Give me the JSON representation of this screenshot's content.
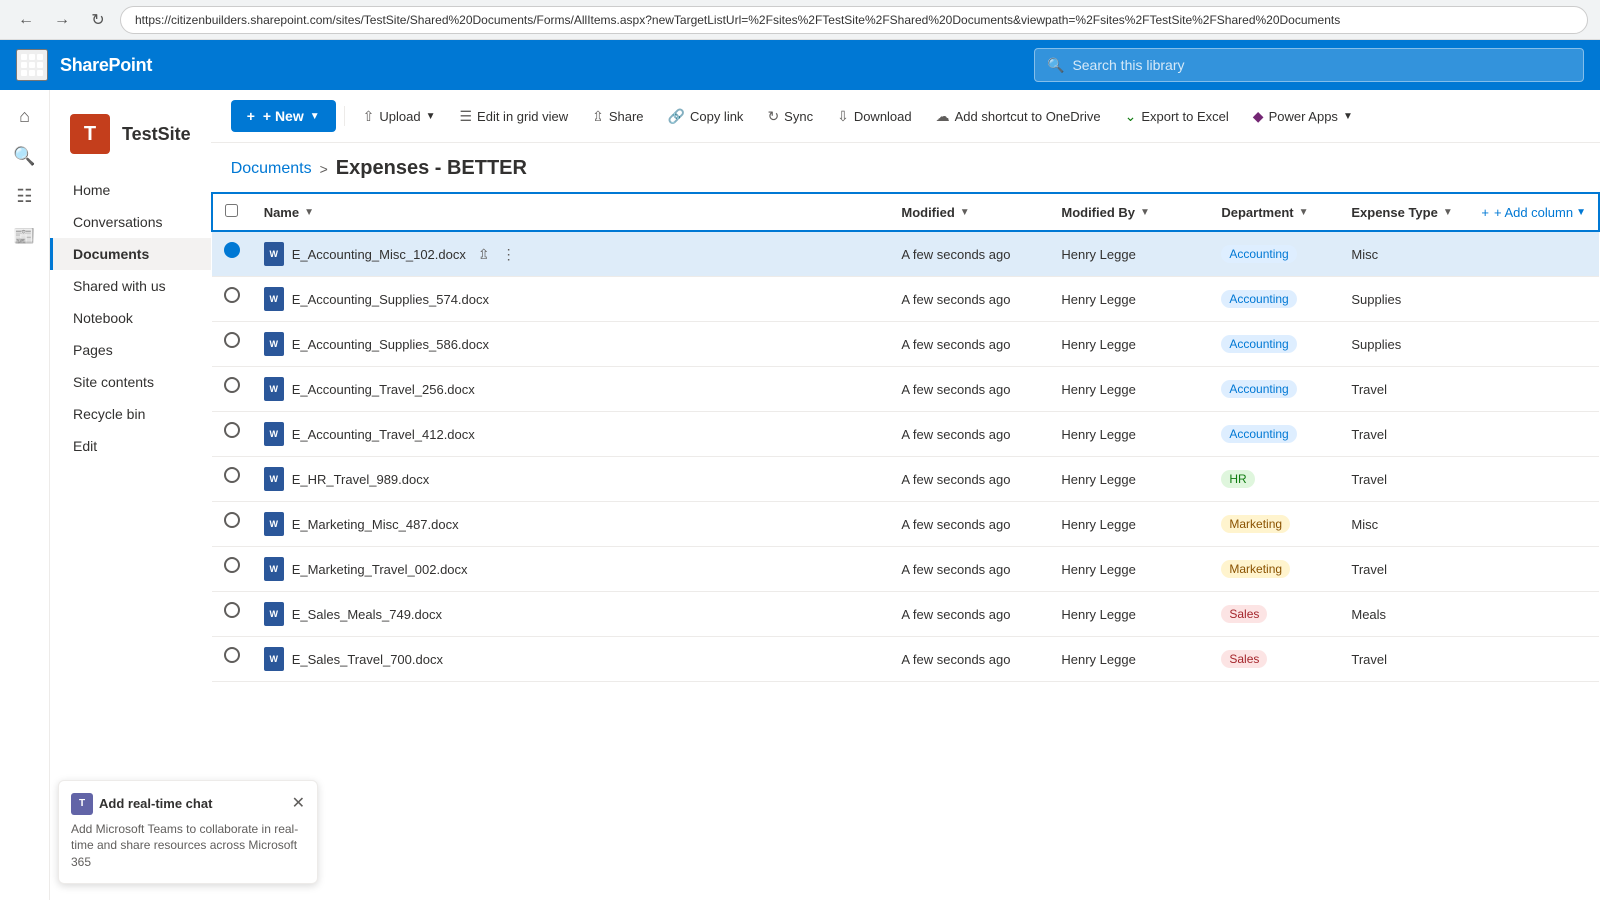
{
  "browser": {
    "address": "https://citizenbuilders.sharepoint.com/sites/TestSite/Shared%20Documents/Forms/AllItems.aspx?newTargetListUrl=%2Fsites%2FTestSite%2FShared%20Documents&viewpath=%2Fsites%2FTestSite%2FShared%20Documents"
  },
  "topnav": {
    "app_name": "SharePoint",
    "search_placeholder": "Search this library"
  },
  "site": {
    "logo_letter": "T",
    "name": "TestSite"
  },
  "nav": {
    "items": [
      {
        "label": "Home",
        "active": false
      },
      {
        "label": "Conversations",
        "active": false
      },
      {
        "label": "Documents",
        "active": true
      },
      {
        "label": "Shared with us",
        "active": false
      },
      {
        "label": "Notebook",
        "active": false
      },
      {
        "label": "Pages",
        "active": false
      },
      {
        "label": "Site contents",
        "active": false
      },
      {
        "label": "Recycle bin",
        "active": false
      },
      {
        "label": "Edit",
        "active": false
      }
    ]
  },
  "toolbar": {
    "new_label": "+ New",
    "upload_label": "Upload",
    "edit_grid_label": "Edit in grid view",
    "share_label": "Share",
    "copy_link_label": "Copy link",
    "sync_label": "Sync",
    "download_label": "Download",
    "add_shortcut_label": "Add shortcut to OneDrive",
    "export_excel_label": "Export to Excel",
    "power_apps_label": "Power Apps"
  },
  "breadcrumb": {
    "parent_label": "Documents",
    "current_label": "Expenses - BETTER"
  },
  "table": {
    "columns": [
      {
        "id": "name",
        "label": "Name",
        "sortable": true
      },
      {
        "id": "modified",
        "label": "Modified",
        "sortable": true
      },
      {
        "id": "modified_by",
        "label": "Modified By",
        "sortable": true
      },
      {
        "id": "department",
        "label": "Department",
        "sortable": true
      },
      {
        "id": "expense_type",
        "label": "Expense Type",
        "sortable": true
      }
    ],
    "add_column_label": "+ Add column",
    "rows": [
      {
        "name": "E_Accounting_Misc_102.docx",
        "modified": "A few seconds ago",
        "modified_by": "Henry Legge",
        "department": "Accounting",
        "dept_class": "accounting",
        "expense_type": "Misc",
        "selected": true
      },
      {
        "name": "E_Accounting_Supplies_574.docx",
        "modified": "A few seconds ago",
        "modified_by": "Henry Legge",
        "department": "Accounting",
        "dept_class": "accounting",
        "expense_type": "Supplies",
        "selected": false
      },
      {
        "name": "E_Accounting_Supplies_586.docx",
        "modified": "A few seconds ago",
        "modified_by": "Henry Legge",
        "department": "Accounting",
        "dept_class": "accounting",
        "expense_type": "Supplies",
        "selected": false
      },
      {
        "name": "E_Accounting_Travel_256.docx",
        "modified": "A few seconds ago",
        "modified_by": "Henry Legge",
        "department": "Accounting",
        "dept_class": "accounting",
        "expense_type": "Travel",
        "selected": false
      },
      {
        "name": "E_Accounting_Travel_412.docx",
        "modified": "A few seconds ago",
        "modified_by": "Henry Legge",
        "department": "Accounting",
        "dept_class": "accounting",
        "expense_type": "Travel",
        "selected": false
      },
      {
        "name": "E_HR_Travel_989.docx",
        "modified": "A few seconds ago",
        "modified_by": "Henry Legge",
        "department": "HR",
        "dept_class": "hr",
        "expense_type": "Travel",
        "selected": false
      },
      {
        "name": "E_Marketing_Misc_487.docx",
        "modified": "A few seconds ago",
        "modified_by": "Henry Legge",
        "department": "Marketing",
        "dept_class": "marketing",
        "expense_type": "Misc",
        "selected": false
      },
      {
        "name": "E_Marketing_Travel_002.docx",
        "modified": "A few seconds ago",
        "modified_by": "Henry Legge",
        "department": "Marketing",
        "dept_class": "marketing",
        "expense_type": "Travel",
        "selected": false
      },
      {
        "name": "E_Sales_Meals_749.docx",
        "modified": "A few seconds ago",
        "modified_by": "Henry Legge",
        "department": "Sales",
        "dept_class": "sales",
        "expense_type": "Meals",
        "selected": false
      },
      {
        "name": "E_Sales_Travel_700.docx",
        "modified": "A few seconds ago",
        "modified_by": "Henry Legge",
        "department": "Sales",
        "dept_class": "sales",
        "expense_type": "Travel",
        "selected": false
      }
    ]
  },
  "chat_widget": {
    "title": "Add real-time chat",
    "description": "Add Microsoft Teams to collaborate in real-time and share resources across Microsoft 365",
    "teams_letter": "T"
  }
}
